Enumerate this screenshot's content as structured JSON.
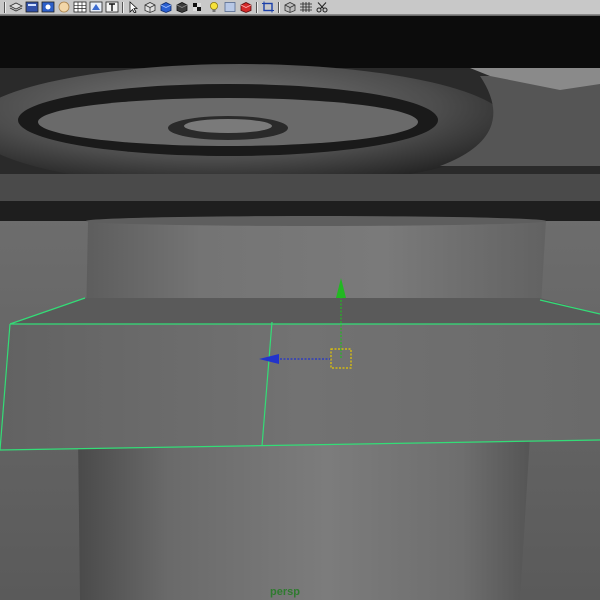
{
  "toolbar": {
    "icons": [
      "script-editor-icon",
      "layers-icon",
      "render-view-icon",
      "light-sphere-icon",
      "grid-icon",
      "uv-editor-icon",
      "text-icon",
      "select-by-hierarchy-icon",
      "display-cube-icon",
      "shaded-cube-icon",
      "texture-cube-icon",
      "light-bulb-icon",
      "material-icon",
      "render-cube-icon",
      "frame-selected-icon",
      "wireframe-cube-icon",
      "grid-toggle-icon",
      "tool-settings-icon"
    ]
  },
  "viewport": {
    "camera_label": "persp",
    "colors": {
      "selection_wire": "#33dd77",
      "manipulator_y": "#22b822",
      "manipulator_x": "#2233cc",
      "manipulator_center": "#e6c800",
      "label_green": "#2f7a2f"
    }
  }
}
